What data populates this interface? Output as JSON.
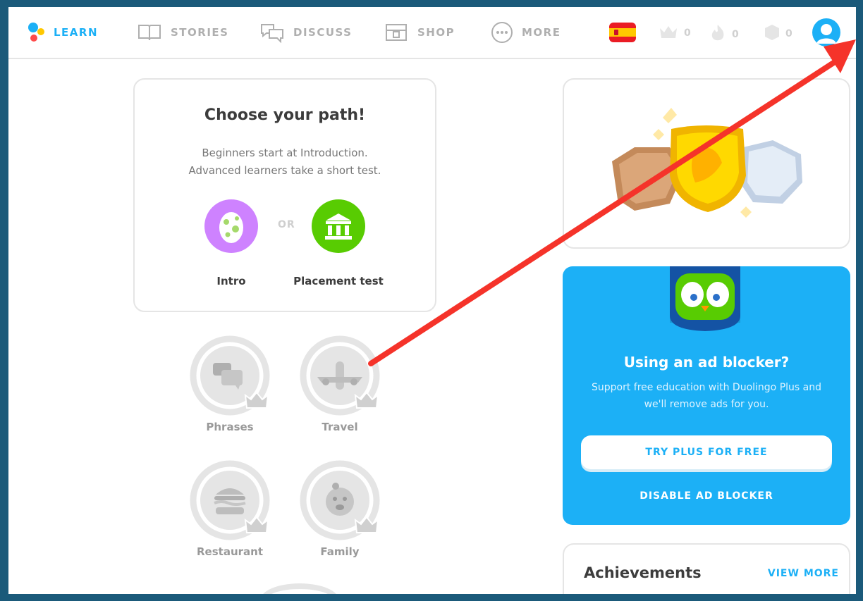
{
  "nav": {
    "items": [
      {
        "label": "LEARN",
        "icon": "duolingo-logo-icon",
        "active": true
      },
      {
        "label": "STORIES",
        "icon": "book-icon"
      },
      {
        "label": "DISCUSS",
        "icon": "speech-bubbles-icon"
      },
      {
        "label": "SHOP",
        "icon": "shop-icon"
      },
      {
        "label": "MORE",
        "icon": "more-dots-icon"
      }
    ],
    "language_flag": "spain-flag-icon",
    "crowns": "0",
    "streak": "0",
    "gems": "0",
    "avatar": "profile-avatar-icon"
  },
  "path_card": {
    "title": "Choose your path!",
    "subtitle_line1": "Beginners start at Introduction.",
    "subtitle_line2": "Advanced learners take a short test.",
    "or": "OR",
    "intro_label": "Intro",
    "placement_label": "Placement test"
  },
  "skills": [
    {
      "label": "Phrases",
      "icon": "speech-bubbles-icon"
    },
    {
      "label": "Travel",
      "icon": "airplane-icon"
    },
    {
      "label": "Restaurant",
      "icon": "burger-icon"
    },
    {
      "label": "Family",
      "icon": "baby-icon"
    }
  ],
  "ad": {
    "title": "Using an ad blocker?",
    "subtitle_line1": "Support free education with Duolingo Plus and",
    "subtitle_line2": "we'll remove ads for you.",
    "try_button": "TRY PLUS FOR FREE",
    "disable_button": "DISABLE AD BLOCKER"
  },
  "achievements": {
    "title": "Achievements",
    "view_more": "VIEW MORE"
  },
  "colors": {
    "accent": "#1cb0f6",
    "arrow": "#f5332a",
    "intro": "#ce82ff",
    "placement": "#58cc02"
  }
}
